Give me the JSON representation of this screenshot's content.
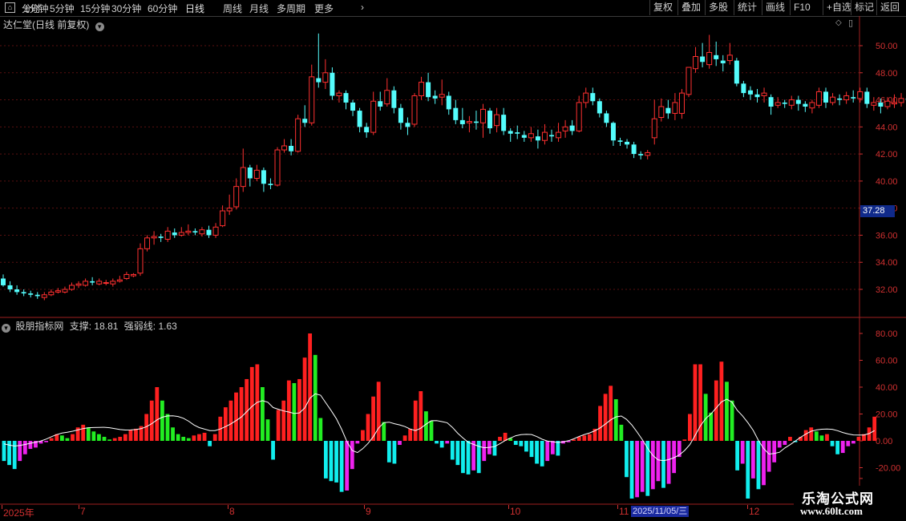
{
  "toolbar": {
    "left_items": [
      "分时",
      "1分钟",
      "5分钟",
      "15分钟",
      "30分钟",
      "60分钟",
      "日线",
      "周线",
      "月线",
      "多周期",
      "更多"
    ],
    "right_items": [
      "复权",
      "叠加",
      "多股",
      "统计",
      "画线",
      "F10",
      "+自选",
      "标记",
      "返回"
    ]
  },
  "price_panel": {
    "title": "达仁堂(日线 前复权)",
    "current_price_label": "37.28",
    "y_ticks": [
      "50.00",
      "48.00",
      "46.00",
      "44.00",
      "42.00",
      "40.00",
      "38.00",
      "36.00",
      "34.00",
      "32.00"
    ]
  },
  "indicator_panel": {
    "name": "股朋指标网",
    "support_label": "支撑:",
    "support_value": "18.81",
    "strength_label": "强弱线:",
    "strength_value": "1.63",
    "y_ticks": [
      "80.00",
      "60.00",
      "40.00",
      "20.00",
      "0.00",
      "-20.00"
    ]
  },
  "date_axis": {
    "labels": [
      "2025年",
      "7",
      "8",
      "9",
      "10",
      "11",
      "12"
    ],
    "cursor_date": "2025/11/05/三"
  },
  "watermark": {
    "title": "乐淘公式网",
    "url": "www.60lt.com"
  },
  "colors": {
    "up": "#ff3030",
    "down": "#54fcfc",
    "pos_bar": "#ff2020",
    "pos_bar_alt": "#22ee22",
    "neg_bar": "#11eeee",
    "neg_bar_alt": "#ee22ee",
    "axis": "#d03030",
    "grid": "#5a1010"
  },
  "chart_data": [
    {
      "type": "candlestick",
      "title": "达仁堂(日线 前复权)",
      "ylim": [
        31.0,
        51.0
      ],
      "series": [
        {
          "name": "达仁堂",
          "values": [
            [
              32.8,
              32.3,
              33.1,
              32.2
            ],
            [
              32.3,
              32.0,
              32.6,
              31.8
            ],
            [
              32.0,
              31.8,
              32.3,
              31.6
            ],
            [
              31.8,
              31.7,
              32.0,
              31.5
            ],
            [
              31.7,
              31.6,
              31.9,
              31.4
            ],
            [
              31.6,
              31.5,
              31.8,
              31.3
            ],
            [
              31.4,
              31.6,
              31.8,
              31.2
            ],
            [
              31.6,
              31.8,
              32.0,
              31.5
            ],
            [
              31.8,
              31.9,
              32.1,
              31.7
            ],
            [
              31.8,
              32.0,
              32.2,
              31.7
            ],
            [
              32.0,
              32.3,
              32.5,
              31.9
            ],
            [
              32.3,
              32.4,
              32.6,
              32.1
            ],
            [
              32.3,
              32.6,
              32.8,
              32.2
            ],
            [
              32.6,
              32.5,
              32.9,
              32.3
            ],
            [
              32.4,
              32.6,
              32.8,
              32.3
            ],
            [
              32.5,
              32.5,
              32.7,
              32.3
            ],
            [
              32.4,
              32.6,
              32.8,
              32.2
            ],
            [
              32.6,
              32.7,
              33.0,
              32.5
            ],
            [
              32.8,
              33.1,
              33.3,
              32.7
            ],
            [
              33.0,
              33.1,
              33.2,
              32.9
            ],
            [
              33.2,
              35.0,
              35.4,
              33.0
            ],
            [
              35.0,
              35.8,
              36.0,
              34.8
            ],
            [
              35.8,
              35.9,
              36.3,
              35.3
            ],
            [
              35.9,
              35.8,
              36.1,
              35.5
            ],
            [
              35.7,
              36.3,
              36.6,
              35.5
            ],
            [
              36.2,
              36.0,
              36.5,
              35.8
            ],
            [
              36.0,
              36.2,
              36.6,
              35.9
            ],
            [
              36.2,
              36.3,
              36.8,
              36.0
            ],
            [
              36.3,
              36.2,
              36.5,
              36.0
            ],
            [
              36.1,
              36.4,
              36.6,
              35.9
            ],
            [
              36.4,
              36.0,
              36.7,
              35.8
            ],
            [
              36.0,
              36.6,
              36.9,
              35.8
            ],
            [
              36.7,
              37.8,
              38.2,
              36.6
            ],
            [
              37.8,
              38.0,
              39.0,
              37.5
            ],
            [
              38.1,
              39.6,
              40.2,
              37.9
            ],
            [
              39.6,
              41.0,
              42.4,
              39.2
            ],
            [
              41.0,
              40.2,
              41.2,
              39.6
            ],
            [
              40.2,
              40.8,
              41.2,
              40.0
            ],
            [
              40.8,
              39.8,
              41.0,
              39.2
            ],
            [
              39.8,
              39.7,
              40.2,
              39.4
            ],
            [
              39.7,
              42.3,
              42.5,
              39.6
            ],
            [
              42.3,
              42.6,
              43.1,
              42.1
            ],
            [
              42.6,
              42.2,
              43.1,
              41.9
            ],
            [
              42.2,
              44.6,
              44.9,
              42.1
            ],
            [
              44.6,
              44.3,
              45.6,
              44.0
            ],
            [
              44.3,
              47.7,
              48.6,
              44.1
            ],
            [
              47.6,
              47.3,
              50.9,
              46.9
            ],
            [
              47.3,
              48.0,
              49.0,
              46.8
            ],
            [
              48.0,
              46.3,
              48.4,
              46.0
            ],
            [
              46.3,
              46.5,
              46.7,
              45.8
            ],
            [
              46.5,
              45.8,
              46.7,
              45.3
            ],
            [
              45.8,
              45.2,
              46.0,
              44.8
            ],
            [
              45.2,
              44.0,
              45.4,
              43.6
            ],
            [
              44.0,
              43.6,
              44.3,
              43.2
            ],
            [
              43.6,
              45.9,
              46.6,
              43.4
            ],
            [
              45.9,
              45.5,
              46.6,
              45.2
            ],
            [
              45.7,
              46.7,
              47.6,
              45.5
            ],
            [
              46.7,
              45.4,
              47.0,
              45.0
            ],
            [
              45.4,
              44.3,
              45.7,
              43.8
            ],
            [
              44.3,
              44.0,
              44.7,
              43.4
            ],
            [
              44.2,
              46.3,
              46.5,
              44.0
            ],
            [
              46.3,
              47.3,
              47.7,
              46.0
            ],
            [
              47.3,
              46.2,
              48.0,
              45.9
            ],
            [
              46.3,
              46.1,
              46.7,
              45.7
            ],
            [
              46.2,
              46.4,
              47.5,
              45.6
            ],
            [
              46.3,
              45.3,
              46.6,
              44.9
            ],
            [
              45.4,
              44.5,
              46.0,
              44.2
            ],
            [
              44.5,
              44.2,
              45.4,
              43.9
            ],
            [
              44.3,
              44.4,
              44.8,
              43.6
            ],
            [
              44.4,
              44.3,
              45.2,
              43.8
            ],
            [
              44.3,
              45.3,
              45.7,
              43.2
            ],
            [
              45.2,
              43.9,
              45.4,
              43.5
            ],
            [
              44.1,
              44.9,
              45.4,
              43.6
            ],
            [
              44.9,
              43.7,
              45.4,
              43.4
            ],
            [
              43.7,
              43.5,
              43.9,
              42.9
            ],
            [
              43.6,
              43.5,
              44.1,
              43.1
            ],
            [
              43.4,
              43.2,
              43.7,
              42.9
            ],
            [
              43.2,
              43.5,
              44.0,
              42.9
            ],
            [
              43.3,
              43.0,
              43.8,
              42.4
            ],
            [
              43.0,
              43.6,
              44.2,
              42.7
            ],
            [
              43.4,
              43.3,
              43.8,
              42.9
            ],
            [
              43.2,
              43.6,
              44.3,
              42.9
            ],
            [
              43.7,
              44.0,
              44.5,
              43.2
            ],
            [
              44.1,
              43.7,
              44.5,
              43.4
            ],
            [
              43.7,
              45.8,
              46.3,
              43.6
            ],
            [
              45.8,
              46.5,
              46.9,
              45.4
            ],
            [
              46.5,
              45.9,
              46.9,
              45.6
            ],
            [
              45.9,
              45.0,
              46.1,
              44.7
            ],
            [
              45.0,
              44.3,
              45.2,
              44.0
            ],
            [
              44.3,
              43.0,
              44.4,
              42.6
            ],
            [
              43.0,
              42.9,
              43.2,
              42.6
            ],
            [
              42.9,
              42.7,
              43.1,
              42.4
            ],
            [
              42.7,
              42.0,
              42.9,
              41.7
            ],
            [
              42.0,
              41.9,
              42.2,
              41.6
            ],
            [
              41.9,
              42.1,
              42.3,
              41.6
            ],
            [
              43.2,
              44.6,
              46.0,
              42.7
            ],
            [
              44.7,
              45.5,
              46.1,
              44.4
            ],
            [
              45.4,
              45.0,
              46.0,
              44.6
            ],
            [
              45.0,
              45.8,
              46.5,
              44.5
            ],
            [
              45.0,
              46.5,
              46.8,
              44.6
            ],
            [
              46.4,
              48.4,
              48.4,
              46.2
            ],
            [
              48.3,
              49.2,
              49.9,
              48.0
            ],
            [
              49.2,
              48.8,
              50.2,
              48.4
            ],
            [
              48.6,
              49.5,
              50.8,
              48.3
            ],
            [
              49.3,
              49.0,
              50.3,
              48.5
            ],
            [
              48.9,
              48.7,
              49.3,
              48.1
            ],
            [
              48.9,
              49.3,
              50.2,
              48.6
            ],
            [
              48.9,
              47.2,
              49.1,
              47.0
            ],
            [
              47.2,
              46.5,
              47.4,
              46.2
            ],
            [
              46.7,
              46.4,
              47.0,
              46.0
            ],
            [
              46.4,
              46.2,
              46.8,
              45.8
            ],
            [
              46.3,
              46.5,
              46.9,
              45.8
            ],
            [
              46.2,
              45.5,
              46.4,
              44.9
            ],
            [
              45.6,
              45.8,
              46.2,
              45.4
            ],
            [
              45.8,
              45.7,
              46.0,
              45.4
            ],
            [
              45.6,
              46.0,
              46.3,
              45.3
            ],
            [
              46.0,
              45.7,
              46.3,
              45.2
            ],
            [
              45.7,
              45.5,
              45.9,
              45.1
            ],
            [
              45.4,
              45.8,
              46.0,
              45.0
            ],
            [
              45.6,
              46.6,
              46.9,
              45.4
            ],
            [
              46.6,
              45.8,
              46.9,
              45.4
            ],
            [
              45.8,
              46.2,
              46.5,
              45.6
            ],
            [
              46.1,
              46.0,
              46.4,
              45.6
            ],
            [
              46.0,
              46.3,
              46.6,
              45.7
            ],
            [
              46.2,
              46.1,
              46.7,
              45.8
            ],
            [
              46.1,
              46.6,
              46.9,
              45.8
            ],
            [
              46.6,
              45.7,
              46.9,
              45.4
            ],
            [
              45.6,
              45.8,
              46.2,
              45.2
            ],
            [
              45.8,
              45.5,
              46.1,
              45.0
            ],
            [
              45.5,
              45.9,
              46.2,
              45.3
            ],
            [
              45.7,
              45.8,
              46.4,
              45.4
            ],
            [
              45.8,
              46.1,
              46.5,
              45.5
            ],
            [
              46.1,
              46.0,
              46.6,
              45.7
            ],
            [
              46.0,
              45.4,
              46.4,
              45.1
            ],
            [
              45.4,
              46.5,
              46.7,
              45.1
            ],
            [
              46.5,
              46.7,
              46.9,
              46.3
            ],
            [
              46.7,
              47.3,
              47.5,
              46.4
            ]
          ]
        }
      ]
    },
    {
      "type": "bar",
      "title": "股朋指标网",
      "ylim": [
        -28.0,
        88.0
      ],
      "series": [
        {
          "name": "柱",
          "values": [
            -15,
            -18,
            -21,
            -15,
            -10,
            -6,
            -5,
            -2,
            -1,
            2,
            5,
            4,
            2,
            5,
            10,
            12,
            10,
            7,
            5,
            3,
            1,
            2,
            3,
            5,
            8,
            9,
            11,
            20,
            30,
            40,
            30,
            20,
            10,
            5,
            3,
            2,
            4,
            5,
            6,
            -4,
            5,
            18,
            25,
            30,
            36,
            40,
            46,
            55,
            57,
            40,
            16,
            -14,
            23,
            30,
            45,
            43,
            46,
            62,
            80,
            64,
            17,
            -28,
            -30,
            -31,
            -38,
            -37,
            -21,
            -2,
            8,
            20,
            33,
            44,
            14,
            -16,
            -17,
            -3,
            4,
            9,
            30,
            37,
            22,
            15,
            -2,
            -5,
            -2,
            -14,
            -18,
            -24,
            -25,
            -22,
            -24,
            -15,
            -10,
            -11,
            3,
            6,
            2,
            -3,
            -4,
            -8,
            -12,
            -17,
            -19,
            -15,
            -10,
            -11,
            -2,
            -1,
            1,
            3,
            4,
            5,
            9,
            26,
            35,
            41,
            31,
            12,
            -27,
            -43,
            -42,
            -38,
            -41,
            -36,
            -30,
            -35,
            -32,
            -24,
            -12,
            1,
            20,
            57,
            57,
            35,
            21,
            45,
            59,
            44,
            30,
            -22,
            -17,
            -43,
            -28,
            -36,
            -33,
            -23,
            -16,
            -5,
            -3,
            3,
            -1,
            3,
            8,
            10,
            7,
            4,
            5,
            -4,
            -10,
            -9,
            -4,
            -2,
            3,
            5,
            10,
            18
          ]
        }
      ]
    }
  ]
}
